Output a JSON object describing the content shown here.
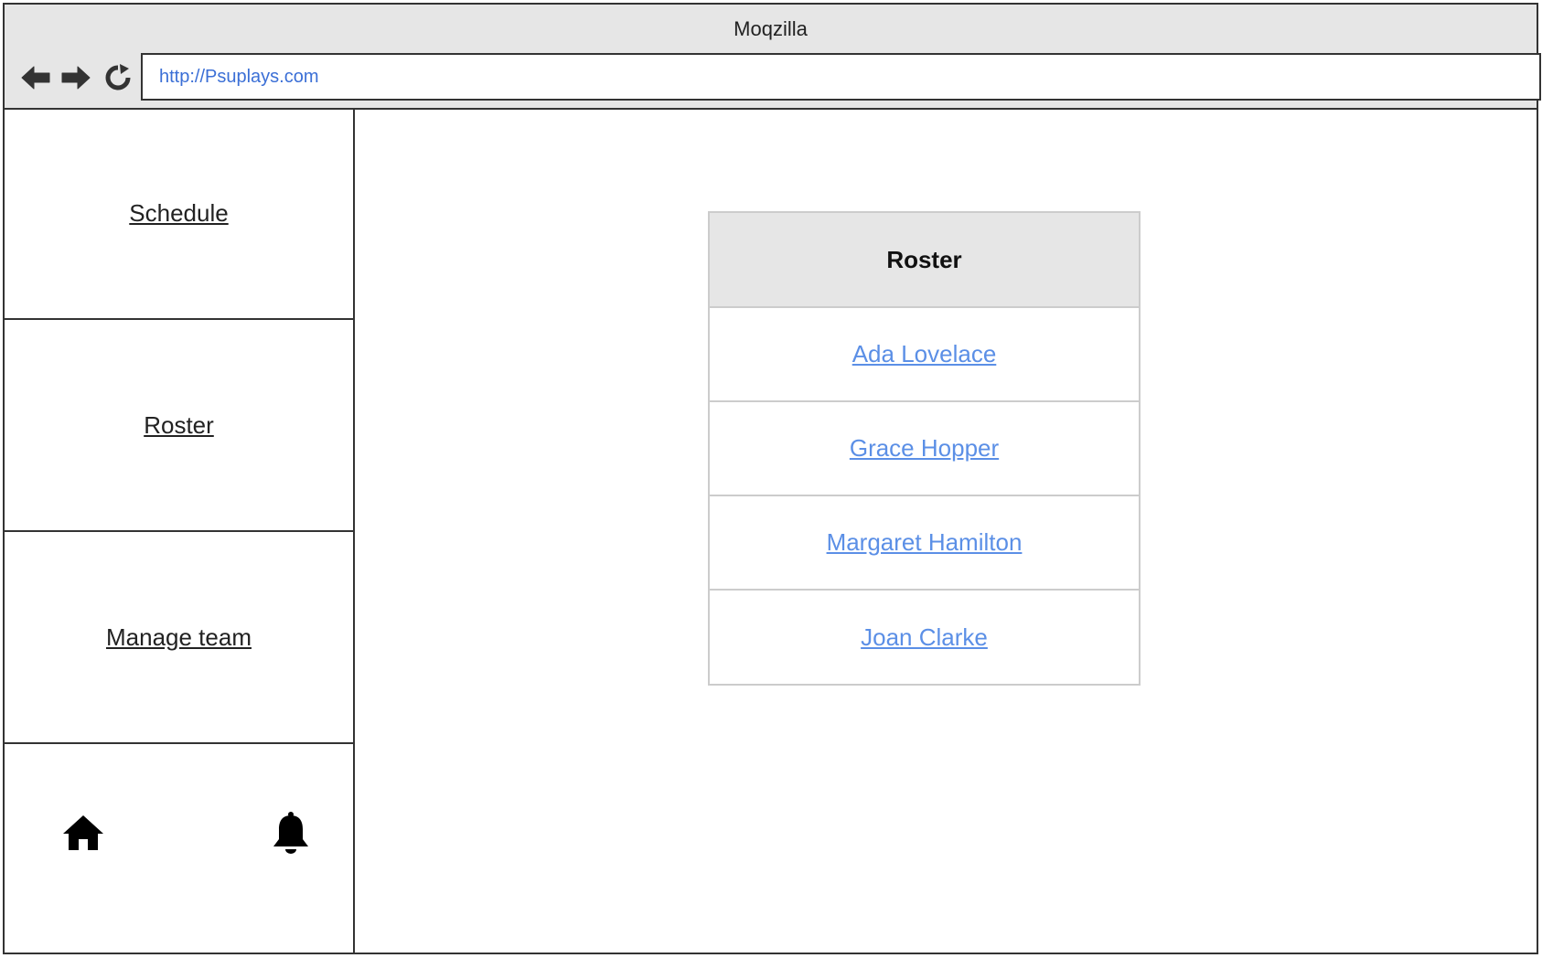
{
  "window": {
    "title": "Moqzilla"
  },
  "toolbar": {
    "back_icon": "arrow-left-icon",
    "forward_icon": "arrow-right-icon",
    "reload_icon": "reload-icon",
    "url": "http://Psuplays.com"
  },
  "sidebar": {
    "items": [
      {
        "label": "Schedule"
      },
      {
        "label": "Roster"
      },
      {
        "label": "Manage team"
      }
    ],
    "footer_icons": [
      "home-icon",
      "bell-icon"
    ]
  },
  "roster": {
    "header": "Roster",
    "players": [
      {
        "name": "Ada Lovelace"
      },
      {
        "name": "Grace Hopper"
      },
      {
        "name": "Margaret Hamilton"
      },
      {
        "name": "Joan Clarke"
      }
    ]
  },
  "colors": {
    "chrome": "#e6e6e6",
    "border": "#333333",
    "link": "#5b8fe6",
    "url_text": "#3b6fd6",
    "table_border": "#cccccc"
  }
}
